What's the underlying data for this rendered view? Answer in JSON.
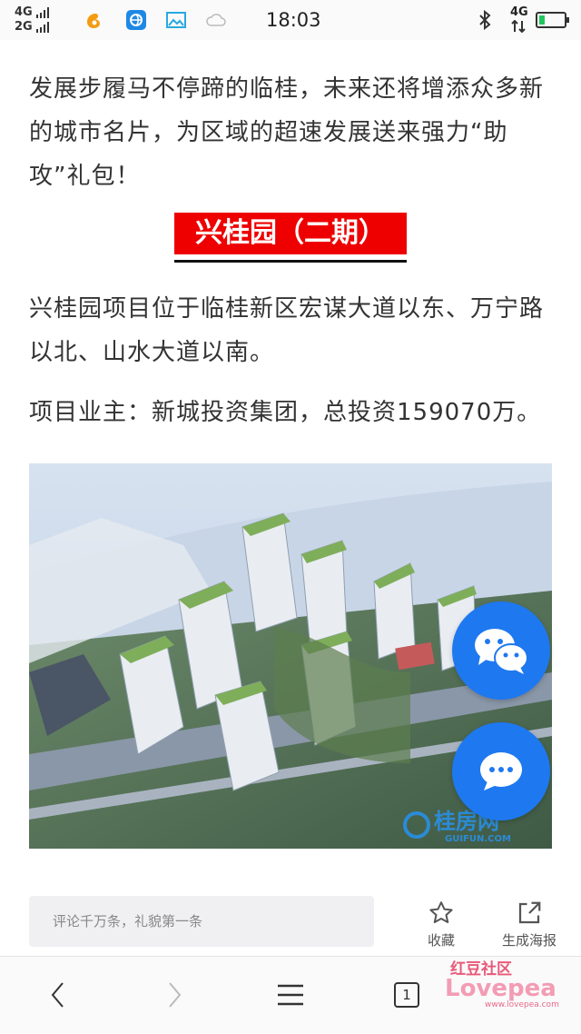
{
  "status_bar": {
    "sim1": "4G",
    "sim2": "2G",
    "time": "18:03",
    "net": "4G"
  },
  "article": {
    "para1": "发展步履马不停蹄的临桂，未来还将增添众多新的城市名片，为区域的超速发展送来强力“助攻”礼包！",
    "section_title": "兴桂园（二期）",
    "para2": "兴桂园项目位于临桂新区宏谋大道以东、万宁路以北、山水大道以南。",
    "para3": "项目业主：新城投资集团，总投资159070万。",
    "image_watermark": "桂房网",
    "image_watermark_sub": "GUIFUN.COM"
  },
  "bottom_bar": {
    "comment_placeholder": "评论千万条，礼貌第一条",
    "favorite_label": "收藏",
    "poster_label": "生成海报"
  },
  "nav_bar": {
    "tab_count": "1"
  },
  "watermark": {
    "text_top": "红豆社区",
    "text_main": "Lovepea",
    "text_url": "www.lovepea.com"
  },
  "colors": {
    "title_bg": "#ee0000",
    "fab_blue": "#1e78f0",
    "status_bg": "#fafafa"
  }
}
